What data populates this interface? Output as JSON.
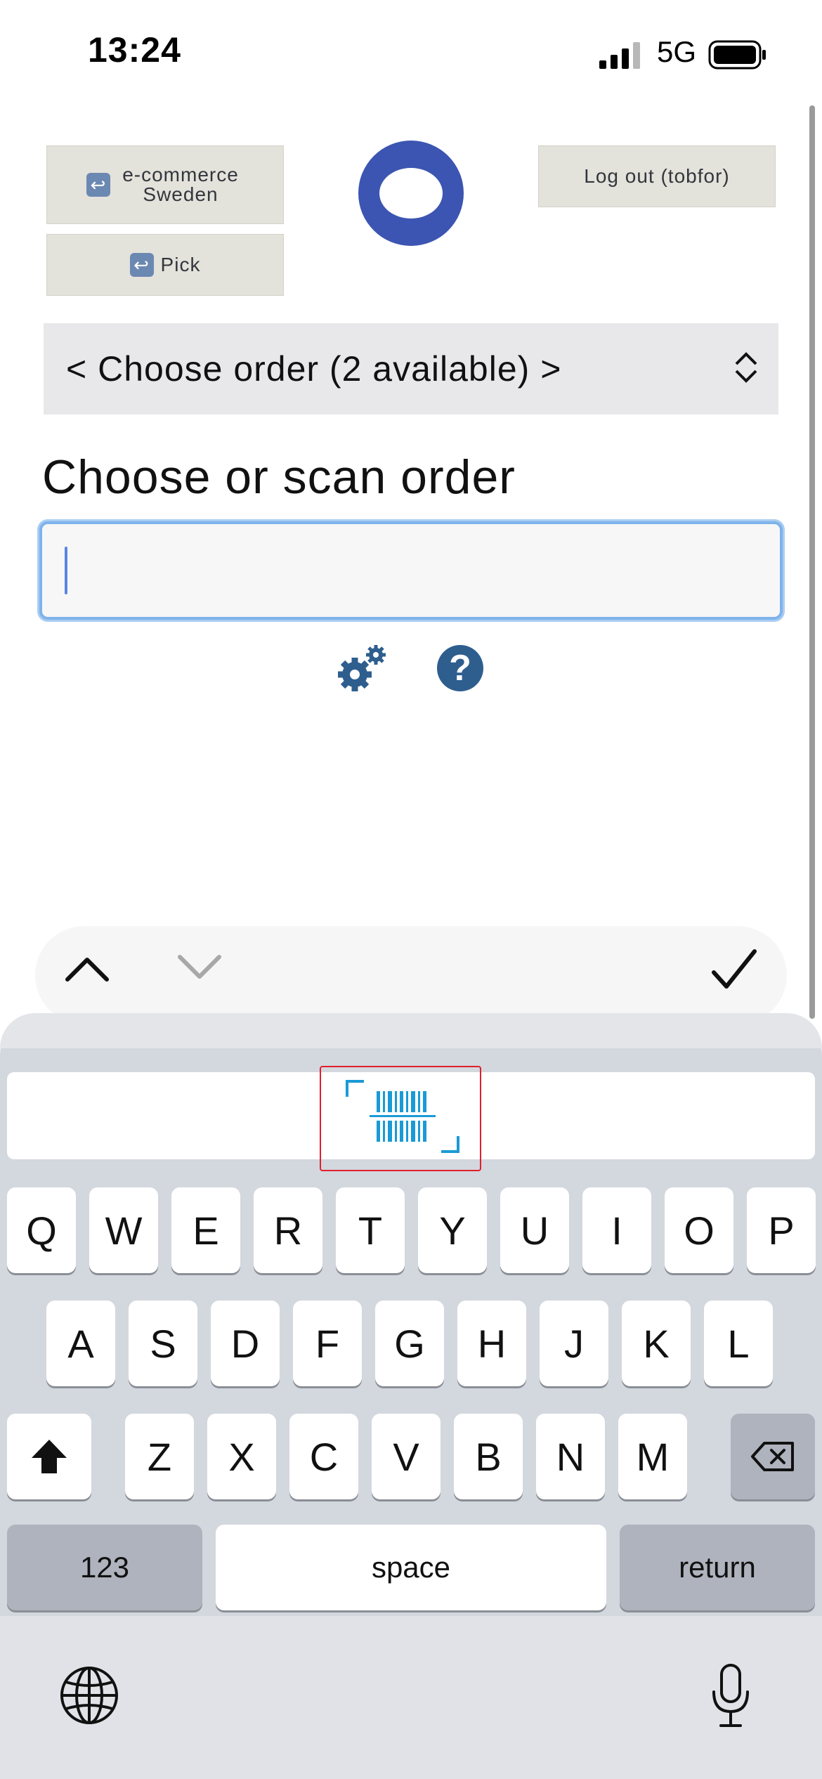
{
  "status_bar": {
    "time": "13:24",
    "network": "5G",
    "icons": [
      "signal-icon",
      "battery-icon"
    ]
  },
  "header": {
    "back_ecommerce_label": "e-commerce Sweden",
    "back_pick_label": "Pick",
    "logout_label": "Log out (tobfor)",
    "logo_icon": "logo-ring-icon"
  },
  "order": {
    "select_value": "< Choose order (2 available) >",
    "heading": "Choose or scan order",
    "input_value": "",
    "input_placeholder": ""
  },
  "tools": {
    "settings_icon": "gears-icon",
    "help_icon": "question-icon",
    "help_glyph": "?"
  },
  "accessory_bar": {
    "up_icon": "chevron-up-icon",
    "down_icon": "chevron-down-icon",
    "done_icon": "checkmark-icon"
  },
  "keyboard": {
    "scan_icon": "barcode-scanner-icon",
    "row1": [
      "Q",
      "W",
      "E",
      "R",
      "T",
      "Y",
      "U",
      "I",
      "O",
      "P"
    ],
    "row2": [
      "A",
      "S",
      "D",
      "F",
      "G",
      "H",
      "J",
      "K",
      "L"
    ],
    "row3": [
      "Z",
      "X",
      "C",
      "V",
      "B",
      "N",
      "M"
    ],
    "numbers_label": "123",
    "space_label": "space",
    "return_label": "return",
    "shift_icon": "shift-icon",
    "delete_icon": "backspace-icon",
    "globe_icon": "globe-icon",
    "mic_icon": "microphone-icon"
  },
  "colors": {
    "brand_blue": "#3c55b2",
    "focus_blue": "#7fb3ea",
    "scan_blue": "#1a9ad6",
    "highlight_red": "#e0202a"
  }
}
